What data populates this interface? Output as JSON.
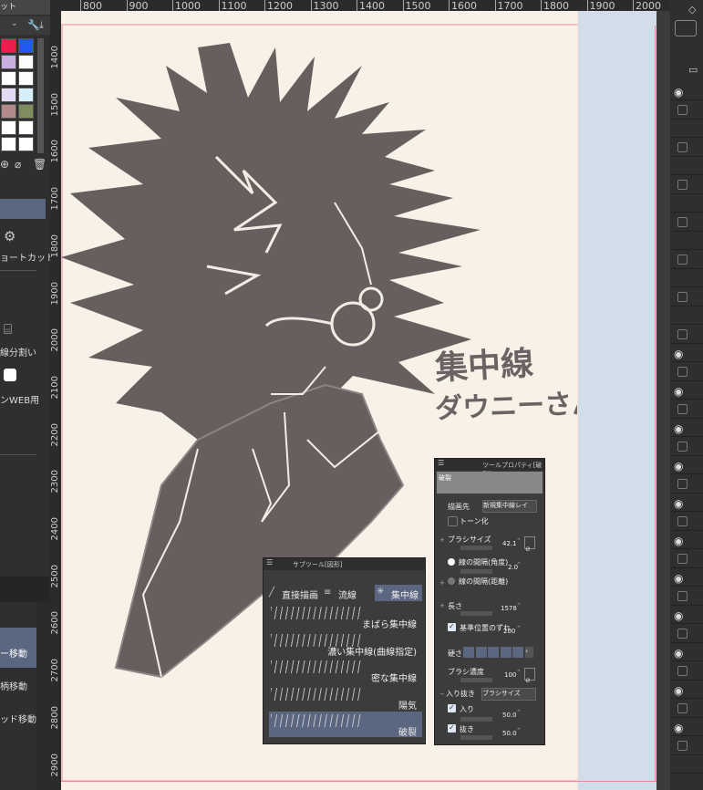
{
  "left_panel": {
    "tab_label": "ット",
    "shortcut_label": "ョートカット",
    "split_label": "線分割い",
    "web_label": "ンWEB用",
    "move_layer_label": "ー移動",
    "move_pattern_label": "柄移動",
    "move_head_label": "ッド移動",
    "swatch_colors": [
      "#ea1f4f",
      "#1f5bf0",
      "#c9aee0",
      "#fbfbfb",
      "#ffffff",
      "#fbfbfb",
      "#e3dbf3",
      "#d6f0fb",
      "#b38a8a",
      "#7f8c5e",
      "#ffffff",
      "#ffffff",
      "#ffffff",
      "#ffffff"
    ]
  },
  "ruler": {
    "top_ticks": [
      "800",
      "900",
      "1000",
      "1100",
      "1200",
      "1300",
      "1400",
      "1500",
      "1600",
      "1700",
      "1800",
      "1900",
      "2000"
    ],
    "left_ticks": [
      "1400",
      "1500",
      "1600",
      "1700",
      "1800",
      "1900",
      "2000",
      "2100",
      "2200",
      "2300",
      "2400",
      "2500",
      "2600",
      "2700",
      "2800",
      "2900"
    ]
  },
  "canvas": {
    "annotation_line1": "集中線",
    "annotation_line2": "ダウニーさん"
  },
  "subtool_panel": {
    "title": "サブツール[図形]",
    "tabs": [
      "直接描画",
      "流線",
      "集中線"
    ],
    "items": [
      "まばら集中線",
      "濃い集中線(曲線指定)",
      "密な集中線",
      "陽気",
      "破裂"
    ]
  },
  "tool_property_panel": {
    "title": "ツールプロパティ[破裂]",
    "preset_name": "破裂",
    "draw_target_label": "描画先",
    "draw_target_value": "新規集中線レイ",
    "tone_label": "トーン化",
    "brush_size_label": "ブラシサイズ",
    "brush_size_value": "42.1",
    "line_angle_label": "線の間隔(角度)",
    "line_angle_value": "2.0",
    "line_distance_label": "線の間隔(距離)",
    "length_label": "長さ",
    "length_value": "1578",
    "offset_label": "基準位置のずれ",
    "offset_value": "200",
    "hardness_label": "硬さ",
    "brush_density_label": "ブラシ濃度",
    "brush_density_value": "100",
    "taper_label": "入り抜き",
    "taper_value": "ブラシサイズ",
    "taper_in_label": "入り",
    "taper_in_value": "50.0",
    "taper_out_label": "抜き",
    "taper_out_value": "50.0"
  }
}
